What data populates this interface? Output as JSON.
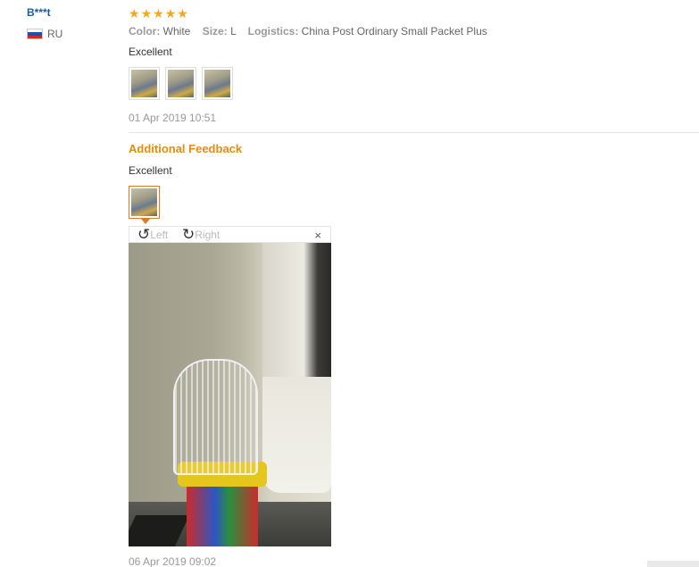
{
  "user": {
    "name": "B***t",
    "country": "RU"
  },
  "review": {
    "rating": 5,
    "attributes": [
      {
        "key": "Color:",
        "value": "White"
      },
      {
        "key": "Size:",
        "value": "L"
      },
      {
        "key": "Logistics:",
        "value": "China Post Ordinary Small Packet Plus"
      }
    ],
    "text": "Excellent",
    "date": "01 Apr 2019 10:51"
  },
  "additional": {
    "heading": "Additional Feedback",
    "text": "Excellent",
    "date": "06 Apr 2019 09:02"
  },
  "viewer": {
    "rotate_left_label": "Left",
    "rotate_right_label": "Right",
    "close_glyph": "×"
  },
  "colors": {
    "accent": "#e78b10",
    "star": "#f6a623",
    "user_link": "#1a5ba8"
  }
}
